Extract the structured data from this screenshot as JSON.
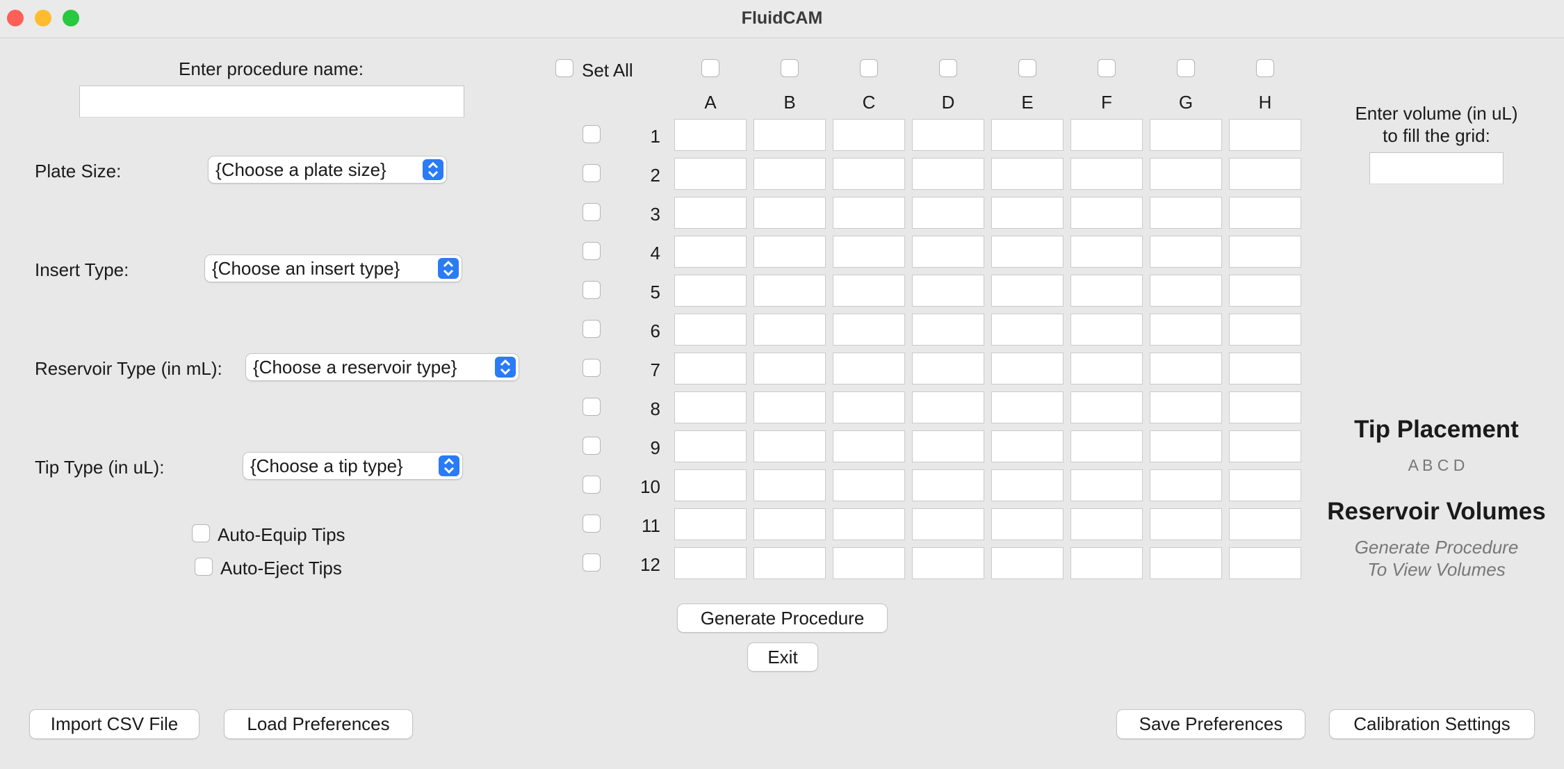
{
  "window": {
    "title": "FluidCAM"
  },
  "left": {
    "procedure_label": "Enter procedure name:",
    "procedure_value": "",
    "plate_size_label": "Plate Size:",
    "plate_size_value": "{Choose a plate size}",
    "insert_type_label": "Insert Type:",
    "insert_type_value": "{Choose an insert type}",
    "reservoir_type_label": "Reservoir Type (in mL):",
    "reservoir_type_value": "{Choose a reservoir type}",
    "tip_type_label": "Tip Type (in uL):",
    "tip_type_value": "{Choose a tip type}",
    "auto_equip_label": "Auto-Equip Tips",
    "auto_eject_label": "Auto-Eject Tips"
  },
  "grid": {
    "set_all_label": "Set All",
    "columns": [
      "A",
      "B",
      "C",
      "D",
      "E",
      "F",
      "G",
      "H"
    ],
    "rows": [
      "1",
      "2",
      "3",
      "4",
      "5",
      "6",
      "7",
      "8",
      "9",
      "10",
      "11",
      "12"
    ]
  },
  "right": {
    "volume_label_line1": "Enter volume (in uL)",
    "volume_label_line2": "to fill the grid:",
    "volume_value": "",
    "tip_placement_title": "Tip Placement",
    "tip_placement_letters": "A B C D",
    "reservoir_volumes_title": "Reservoir Volumes",
    "reservoir_hint_line1": "Generate Procedure",
    "reservoir_hint_line2": "To View Volumes"
  },
  "actions": {
    "generate": "Generate Procedure",
    "exit": "Exit",
    "import_csv": "Import CSV File",
    "load_prefs": "Load Preferences",
    "save_prefs": "Save Preferences",
    "calibration": "Calibration Settings"
  },
  "colors": {
    "close": "#fe5f57",
    "minimize": "#febc2e",
    "zoom": "#28c840",
    "accent": "#2a7bf6"
  }
}
